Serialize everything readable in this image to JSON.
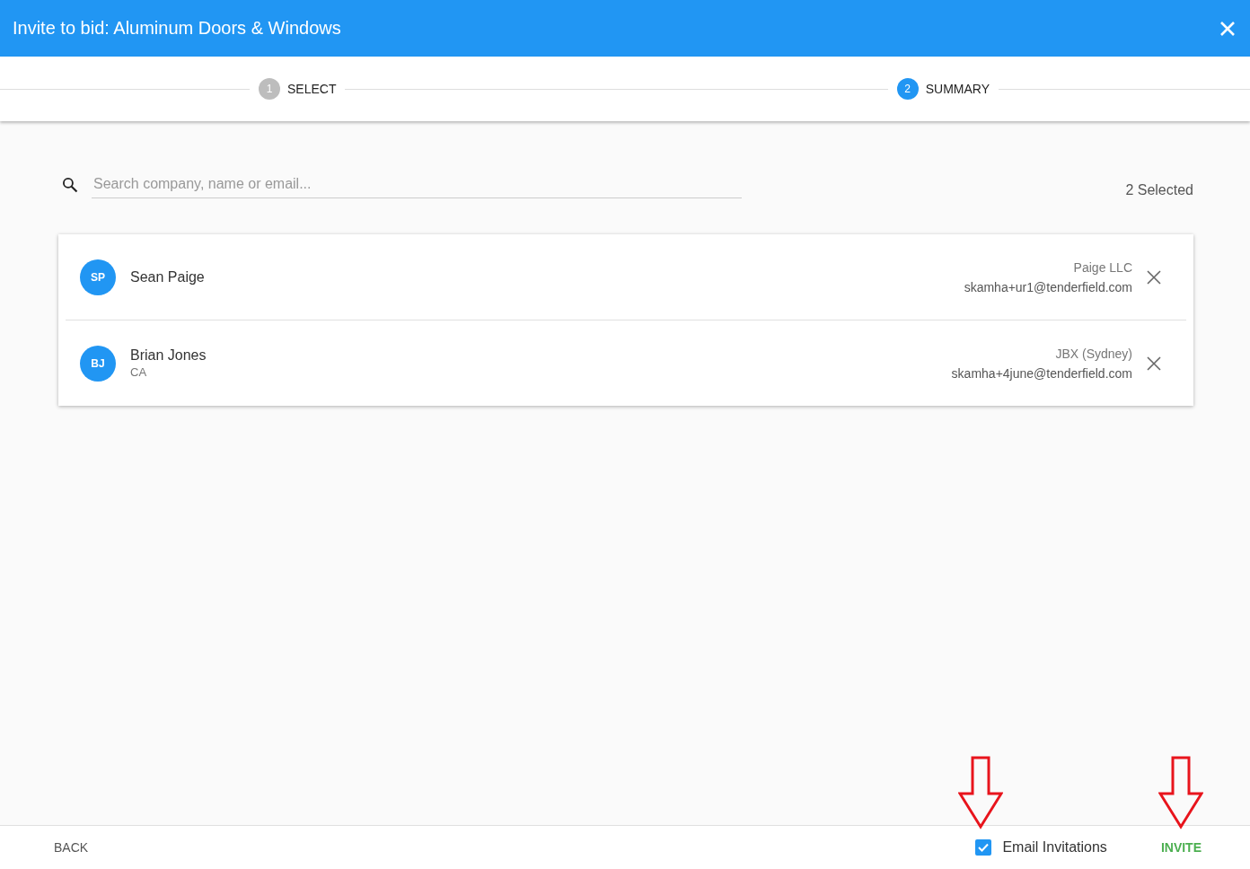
{
  "dialog": {
    "title": "Invite to bid: Aluminum Doors & Windows"
  },
  "steps": [
    {
      "number": "1",
      "label": "SELECT",
      "selected": false
    },
    {
      "number": "2",
      "label": "SUMMARY",
      "selected": true
    }
  ],
  "search": {
    "placeholder": "Search company, name or email..."
  },
  "selected_count": "2 Selected",
  "invitees": [
    {
      "initials": "SP",
      "name": "Sean Paige",
      "company": "Paige LLC",
      "email": "skamha+ur1@tenderfield.com"
    },
    {
      "initials": "BJ",
      "name": "Brian Jones",
      "subtitle": "CA",
      "company": "JBX (Sydney)",
      "email": "skamha+4june@tenderfield.com"
    }
  ],
  "footer": {
    "back": "BACK",
    "email_invitations": {
      "label": "Email Invitations",
      "checked": true
    },
    "invite": "INVITE"
  }
}
